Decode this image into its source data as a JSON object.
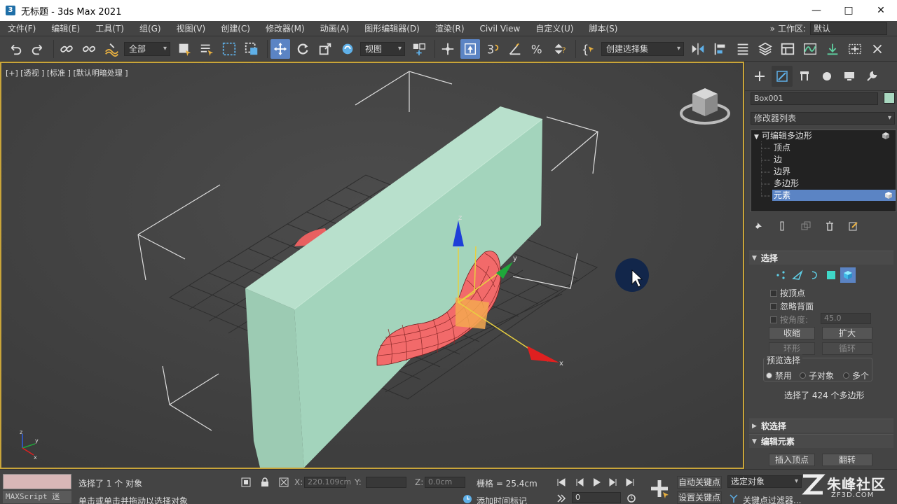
{
  "window": {
    "title": "无标题 - 3ds Max 2021",
    "app_icon": "3"
  },
  "menu": {
    "items": [
      "文件(F)",
      "编辑(E)",
      "工具(T)",
      "组(G)",
      "视图(V)",
      "创建(C)",
      "修改器(M)",
      "动画(A)",
      "图形编辑器(D)",
      "渲染(R)",
      "Civil View",
      "自定义(U)",
      "脚本(S)"
    ],
    "workspace_label": "工作区:",
    "workspace_value": "默认"
  },
  "toolbar": {
    "filter_value": "全部",
    "coord_value": "视图",
    "selection_set_value": "创建选择集"
  },
  "viewport": {
    "label": "[+] [透视 ] [标准 ] [默认明暗处理 ]",
    "axis_x": "x",
    "axis_y": "y",
    "axis_z": "z"
  },
  "command_panel": {
    "object_name": "Box001",
    "object_color": "#a9d8c0",
    "modifier_list": "修改器列表",
    "stack": {
      "root": "可编辑多边形",
      "items": [
        "顶点",
        "边",
        "边界",
        "多边形",
        "元素"
      ],
      "selected": "元素"
    },
    "selection": {
      "title": "选择",
      "by_vertex": "按顶点",
      "ignore_backface": "忽略背面",
      "by_angle_label": "按角度:",
      "by_angle_value": "45.0",
      "shrink": "收缩",
      "grow": "扩大",
      "ring": "环形",
      "loop": "循环",
      "preview_title": "预览选择",
      "preview_options": [
        "禁用",
        "子对象",
        "多个"
      ],
      "status": "选择了 424 个多边形"
    },
    "soft_selection_title": "软选择",
    "edit_elements": {
      "title": "编辑元素",
      "insert_vertex": "插入顶点",
      "flip": "翻转"
    }
  },
  "status_bar": {
    "maxscript": "MAXScript 迷",
    "message_top": "选择了 1 个 对象",
    "message_bottom": "单击或单击并拖动以选择对象",
    "x_label": "X:",
    "x_value": "220.109cm",
    "y_label": "Y:",
    "y_value": "",
    "z_label": "Z:",
    "z_value": "0.0cm",
    "grid": "栅格 = 25.4cm",
    "add_time_tag": "添加时间标记",
    "frame_value": "0",
    "auto_key": "自动关键点",
    "set_key": "设置关键点",
    "selected_object": "选定对象",
    "key_filters": "关键点过滤器..."
  },
  "watermark": {
    "text": "朱峰社区",
    "url": "ZF3D.COM"
  }
}
